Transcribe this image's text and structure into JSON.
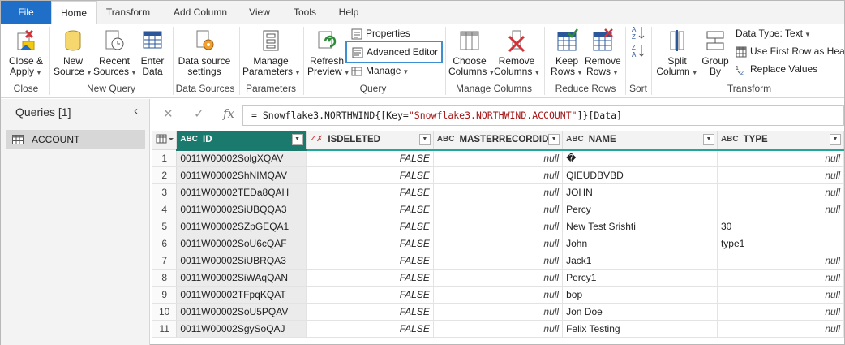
{
  "tabs": [
    "File",
    "Home",
    "Transform",
    "Add Column",
    "View",
    "Tools",
    "Help"
  ],
  "ribbon": {
    "close_apply": [
      "Close &",
      "Apply"
    ],
    "new_source": [
      "New",
      "Source"
    ],
    "recent_sources": [
      "Recent",
      "Sources"
    ],
    "enter_data": [
      "Enter",
      "Data"
    ],
    "data_source_settings": [
      "Data source",
      "settings"
    ],
    "manage_parameters": [
      "Manage",
      "Parameters"
    ],
    "refresh_preview": [
      "Refresh",
      "Preview"
    ],
    "properties": "Properties",
    "advanced_editor": "Advanced Editor",
    "manage": "Manage",
    "choose_columns": [
      "Choose",
      "Columns"
    ],
    "remove_columns": [
      "Remove",
      "Columns"
    ],
    "keep_rows": [
      "Keep",
      "Rows"
    ],
    "remove_rows": [
      "Remove",
      "Rows"
    ],
    "split_column": [
      "Split",
      "Column"
    ],
    "group_by": [
      "Group",
      "By"
    ],
    "data_type": "Data Type: Text",
    "use_first_row": "Use First Row as Headers",
    "replace_values": "Replace Values",
    "groups": {
      "close": "Close",
      "new_query": "New Query",
      "data_sources": "Data Sources",
      "parameters": "Parameters",
      "query": "Query",
      "manage_columns": "Manage Columns",
      "reduce_rows": "Reduce Rows",
      "sort": "Sort",
      "transform": "Transform"
    }
  },
  "queries": {
    "title": "Queries [1]",
    "items": [
      "ACCOUNT"
    ]
  },
  "formula": {
    "prefix": "= Snowflake3.NORTHWIND{[Key=",
    "string": "\"Snowflake3.NORTHWIND.ACCOUNT\"",
    "suffix": "]}[Data]"
  },
  "grid": {
    "columns": [
      {
        "type_icon": "ABC",
        "name": "ID"
      },
      {
        "type_icon": "✓✗",
        "name": "ISDELETED"
      },
      {
        "type_icon": "ABC",
        "name": "MASTERRECORDID"
      },
      {
        "type_icon": "ABC",
        "name": "NAME"
      },
      {
        "type_icon": "ABC",
        "name": "TYPE"
      }
    ],
    "rows": [
      [
        "1",
        "0011W00002SolgXQAV",
        "FALSE",
        "null",
        "�",
        "null"
      ],
      [
        "2",
        "0011W00002ShNIMQAV",
        "FALSE",
        "null",
        "QIEUDBVBD",
        "null"
      ],
      [
        "3",
        "0011W00002TEDa8QAH",
        "FALSE",
        "null",
        "JOHN",
        "null"
      ],
      [
        "4",
        "0011W00002SiUBQQA3",
        "FALSE",
        "null",
        "Percy",
        "null"
      ],
      [
        "5",
        "0011W00002SZpGEQA1",
        "FALSE",
        "null",
        "New Test Srishti",
        "30"
      ],
      [
        "6",
        "0011W00002SoU6cQAF",
        "FALSE",
        "null",
        "John",
        "type1"
      ],
      [
        "7",
        "0011W00002SiUBRQA3",
        "FALSE",
        "null",
        "Jack1",
        "null"
      ],
      [
        "8",
        "0011W00002SiWAqQAN",
        "FALSE",
        "null",
        "Percy1",
        "null"
      ],
      [
        "9",
        "0011W00002TFpqKQAT",
        "FALSE",
        "null",
        "bop",
        "null"
      ],
      [
        "10",
        "0011W00002SoU5PQAV",
        "FALSE",
        "null",
        "Jon Doe",
        "null"
      ],
      [
        "11",
        "0011W00002SgySoQAJ",
        "FALSE",
        "null",
        "Felix Testing",
        "null"
      ]
    ]
  },
  "colors": {
    "file_tab": "#1f6fc9",
    "selected_header": "#1a7a6d",
    "header_underline": "#23a69a",
    "highlight_outline": "#3c8fd0"
  }
}
